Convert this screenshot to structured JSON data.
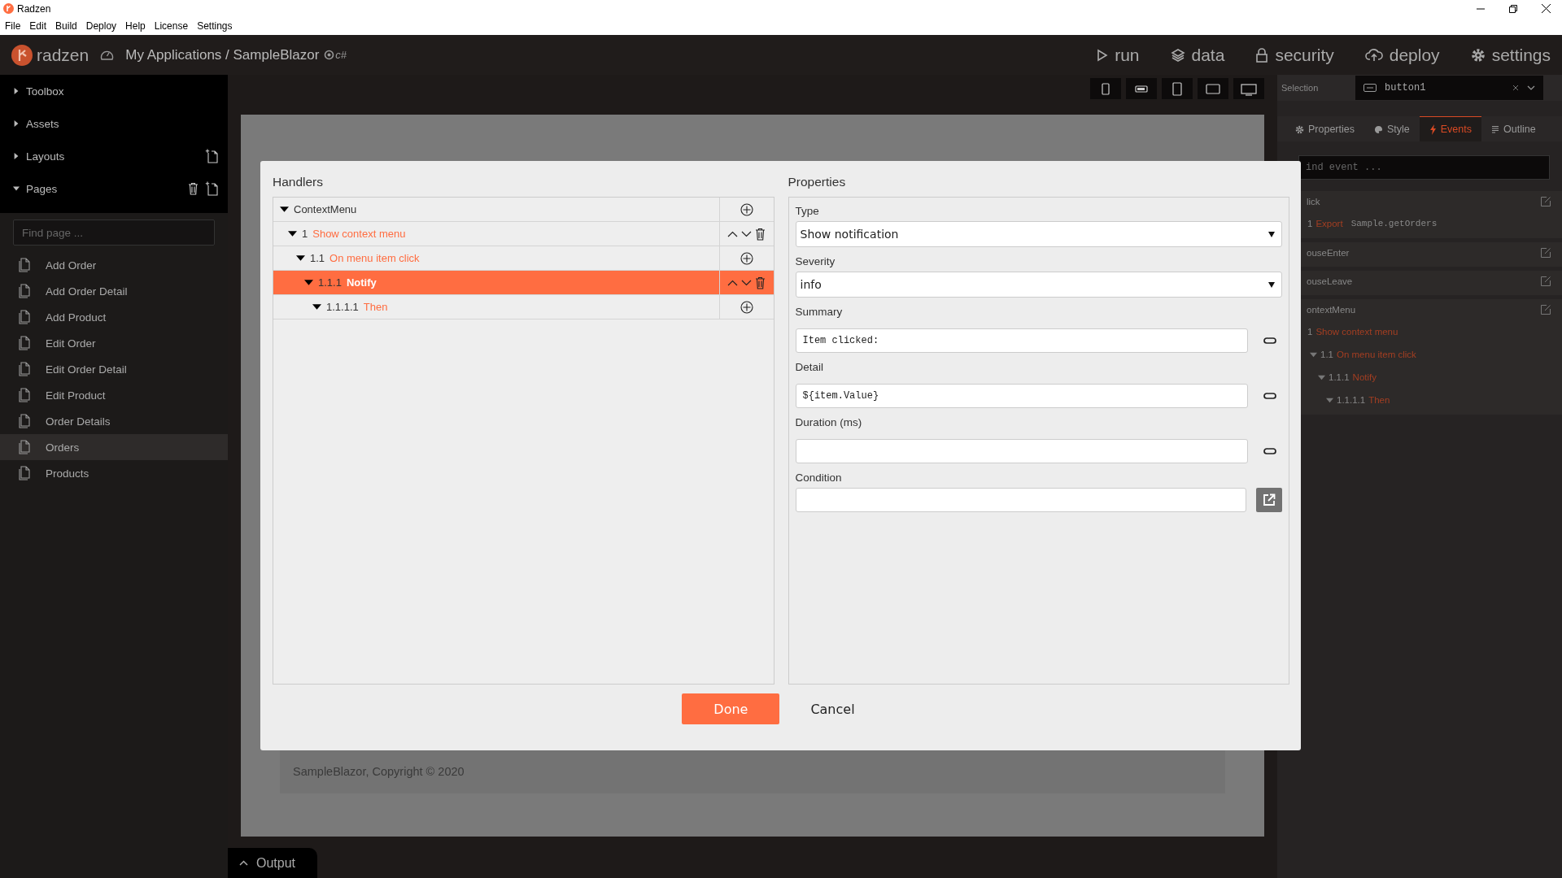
{
  "window": {
    "title": "Radzen"
  },
  "menu": [
    "File",
    "Edit",
    "Build",
    "Deploy",
    "Help",
    "License",
    "Settings"
  ],
  "header": {
    "logo": "radzen",
    "breadcrumb": "My Applications / SampleBlazor",
    "project_tag": "c#",
    "nav": [
      {
        "kind": "run",
        "label": "run"
      },
      {
        "kind": "data",
        "label": "data"
      },
      {
        "kind": "security",
        "label": "security"
      },
      {
        "kind": "deploy",
        "label": "deploy"
      },
      {
        "kind": "settings",
        "label": "settings"
      }
    ]
  },
  "sidebar": {
    "sections": [
      {
        "label": "Toolbox",
        "expanded": false,
        "kind": "plain"
      },
      {
        "label": "Assets",
        "expanded": false,
        "kind": "plain"
      },
      {
        "label": "Layouts",
        "expanded": false,
        "kind": "creatable"
      },
      {
        "label": "Pages",
        "expanded": true,
        "kind": "managed"
      }
    ],
    "search": {
      "placeholder": "Find page ..."
    },
    "pages": [
      {
        "label": "Add Order",
        "selected": false
      },
      {
        "label": "Add Order Detail",
        "selected": false
      },
      {
        "label": "Add Product",
        "selected": false
      },
      {
        "label": "Edit Order",
        "selected": false
      },
      {
        "label": "Edit Order Detail",
        "selected": false
      },
      {
        "label": "Edit Product",
        "selected": false
      },
      {
        "label": "Order Details",
        "selected": false
      },
      {
        "label": "Orders",
        "selected": true
      },
      {
        "label": "Products",
        "selected": false
      }
    ]
  },
  "device_buttons": [
    {
      "kind": "phone"
    },
    {
      "kind": "phone-landscape"
    },
    {
      "kind": "tablet"
    },
    {
      "kind": "tablet-landscape"
    },
    {
      "kind": "desktop"
    }
  ],
  "canvas": {
    "footer": "SampleBlazor, Copyright © 2020"
  },
  "output_tab": {
    "label": "Output"
  },
  "right_panel": {
    "selection_label": "Selection",
    "selection_value": "button1",
    "tabs": [
      {
        "kind": "properties",
        "label": "Properties",
        "selected": false
      },
      {
        "kind": "style",
        "label": "Style",
        "selected": false
      },
      {
        "kind": "events",
        "label": "Events",
        "selected": true
      },
      {
        "kind": "outline",
        "label": "Outline",
        "selected": false
      }
    ],
    "search": {
      "placeholder": "ind event ..."
    },
    "events": [
      {
        "name": "lick",
        "handlers": [
          {
            "number": "1",
            "action": "Export",
            "detail": "Sample.getOrders"
          }
        ]
      },
      {
        "name": "ouseEnter"
      },
      {
        "name": "ouseLeave"
      },
      {
        "name": "ontextMenu",
        "handlers": [
          {
            "number": "1",
            "action": "Show context menu",
            "children": [
              {
                "number": "1.1",
                "action": "On menu item click",
                "expanded": true,
                "children": [
                  {
                    "number": "1.1.1",
                    "action": "Notify",
                    "expanded": true,
                    "children": [
                      {
                        "number": "1.1.1.1",
                        "action": "Then",
                        "expanded": true
                      }
                    ]
                  }
                ]
              }
            ]
          }
        ]
      }
    ]
  },
  "dialog": {
    "handlers_title": "Handlers",
    "properties_title": "Properties",
    "tree": {
      "label": "ContextMenu",
      "expanded": true,
      "selected": false,
      "kind": "container",
      "children": [
        {
          "number": "1",
          "label": "Show context menu",
          "expanded": true,
          "selected": false,
          "kind": "step",
          "children": [
            {
              "number": "1.1",
              "label": "On menu item click",
              "expanded": true,
              "selected": false,
              "kind": "container",
              "children": [
                {
                  "number": "1.1.1",
                  "label": "Notify",
                  "expanded": true,
                  "selected": true,
                  "kind": "step",
                  "children": [
                    {
                      "number": "1.1.1.1",
                      "label": "Then",
                      "expanded": true,
                      "selected": false,
                      "kind": "container"
                    }
                  ]
                }
              ]
            }
          ]
        }
      ]
    },
    "fields": [
      {
        "label": "Type",
        "kind": "select",
        "value": "Show notification"
      },
      {
        "label": "Severity",
        "kind": "select",
        "value": "info"
      },
      {
        "label": "Summary",
        "kind": "bound",
        "value": "Item clicked:"
      },
      {
        "label": "Detail",
        "kind": "bound",
        "value": "${item.Value}"
      },
      {
        "label": "Duration (ms)",
        "kind": "bound"
      },
      {
        "label": "Condition",
        "kind": "expression"
      }
    ],
    "buttons": [
      {
        "kind": "primary",
        "label": "Done"
      },
      {
        "kind": "plain",
        "label": "Cancel"
      }
    ]
  }
}
